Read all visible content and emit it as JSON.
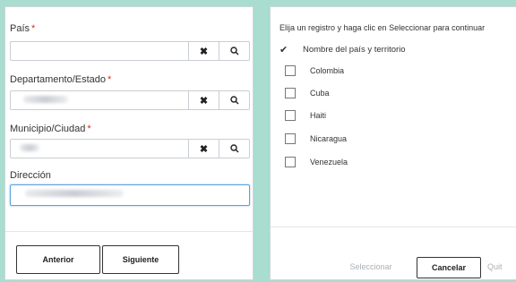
{
  "form": {
    "country": {
      "label": "País",
      "required_mark": "*"
    },
    "state": {
      "label": "Departamento/Estado",
      "required_mark": "*"
    },
    "city": {
      "label": "Municipio/Ciudad",
      "required_mark": "*"
    },
    "address": {
      "label": "Dirección"
    },
    "clear_symbol": "✖",
    "search_symbol": "🔍",
    "back_label": "Anterior",
    "next_label": "Siguiente"
  },
  "picker": {
    "instruction": "Elija un registro y haga clic en Seleccionar para continuar",
    "header_check": "✔",
    "column_title": "Nombre del país y territorio",
    "items": [
      "Colombia",
      "Cuba",
      "Haiti",
      "Nicaragua",
      "Venezuela"
    ],
    "select_label": "Seleccionar",
    "cancel_label": "Cancelar",
    "remove_label": "Quit"
  },
  "colors": {
    "background": "#a8ddd0",
    "required": "#d0341c",
    "focus_border": "#5aa3e0"
  }
}
